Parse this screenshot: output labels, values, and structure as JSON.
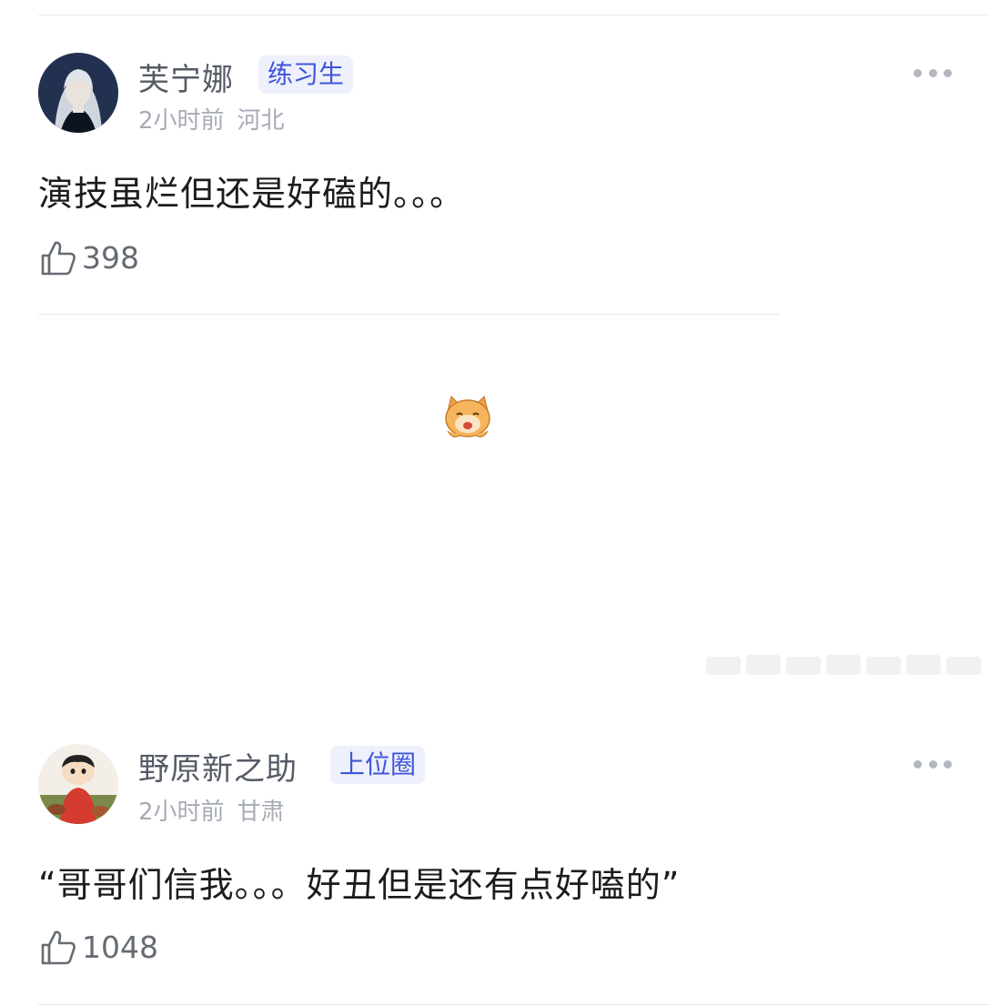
{
  "comments": [
    {
      "username": "芙宁娜",
      "badge": "练习生",
      "time": "2小时前",
      "location": "河北",
      "text": "演技虽烂但还是好磕的。。。",
      "likes": "398"
    },
    {
      "username": "野原新之助",
      "badge": "上位圈",
      "time": "2小时前",
      "location": "甘肃",
      "text": "“哥哥们信我。。。好丑但是还有点好嗑的”",
      "likes": "1048"
    }
  ],
  "icons": {
    "like": "thumbs-up-icon",
    "more": "more-options-icon",
    "emoji": "cat-sticker-icon"
  },
  "colors": {
    "badge_text": "#3e55d8",
    "badge_bg": "#eef0fb",
    "username": "#555b66",
    "meta": "#a6abb4"
  }
}
